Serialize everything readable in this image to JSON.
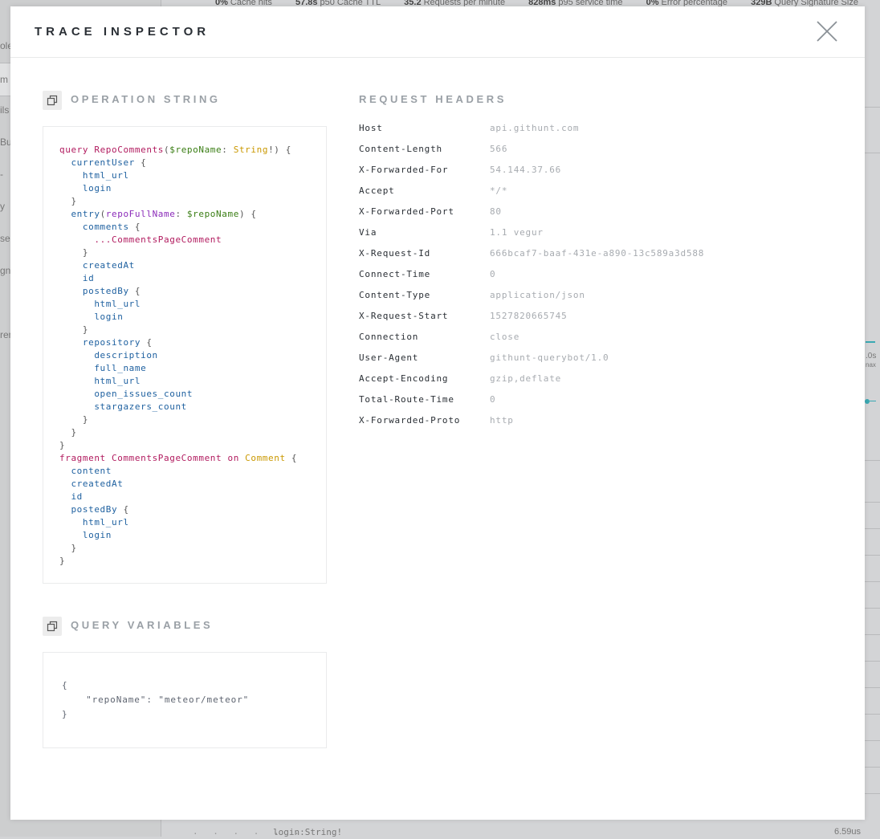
{
  "background": {
    "stats": [
      {
        "value": "0%",
        "label": "Cache hits"
      },
      {
        "value": "57.8s",
        "label": "p50 Cache TTL"
      },
      {
        "value": "35.2",
        "label": "Requests per minute"
      },
      {
        "value": "828ms",
        "label": "p95 service time"
      },
      {
        "value": "0%",
        "label": "Error percentage"
      },
      {
        "value": "329B",
        "label": "Query Signature Size"
      }
    ],
    "sidebar_fragments": [
      "ole",
      "m",
      "ils",
      "Bu",
      "-",
      "y",
      "ser",
      "gna",
      "rem"
    ],
    "bottom_row": {
      "dots": "· · · · · ·",
      "field": "login:String!",
      "duration": "6.59us"
    },
    "right_fragments": {
      "a": ".0s",
      "b": "nax"
    }
  },
  "modal": {
    "title": "TRACE INSPECTOR",
    "close_icon": "close-icon",
    "operation": {
      "title": "OPERATION STRING",
      "copy_icon": "copy-icon"
    },
    "variables": {
      "title": "QUERY VARIABLES",
      "copy_icon": "copy-icon",
      "text": "{\n    \"repoName\": \"meteor/meteor\"\n}"
    },
    "headers": {
      "title": "REQUEST HEADERS",
      "rows": [
        {
          "name": "Host",
          "value": "api.githunt.com"
        },
        {
          "name": "Content-Length",
          "value": "566"
        },
        {
          "name": "X-Forwarded-For",
          "value": "54.144.37.66"
        },
        {
          "name": "Accept",
          "value": "*/*"
        },
        {
          "name": "X-Forwarded-Port",
          "value": "80"
        },
        {
          "name": "Via",
          "value": "1.1 vegur"
        },
        {
          "name": "X-Request-Id",
          "value": "666bcaf7-baaf-431e-a890-13c589a3d588"
        },
        {
          "name": "Connect-Time",
          "value": "0"
        },
        {
          "name": "Content-Type",
          "value": "application/json"
        },
        {
          "name": "X-Request-Start",
          "value": "1527820665745"
        },
        {
          "name": "Connection",
          "value": "close"
        },
        {
          "name": "User-Agent",
          "value": "githunt-querybot/1.0"
        },
        {
          "name": "Accept-Encoding",
          "value": "gzip,deflate"
        },
        {
          "name": "Total-Route-Time",
          "value": "0"
        },
        {
          "name": "X-Forwarded-Proto",
          "value": "http"
        }
      ]
    }
  },
  "operation_code": [
    [
      [
        "kw",
        "query "
      ],
      [
        "def",
        "RepoComments"
      ],
      [
        "p",
        "("
      ],
      [
        "var",
        "$repoName"
      ],
      [
        "p",
        ": "
      ],
      [
        "type",
        "String"
      ],
      [
        "p",
        "!) {"
      ]
    ],
    [
      [
        "f",
        "  currentUser"
      ],
      [
        "p",
        " {"
      ]
    ],
    [
      [
        "f",
        "    html_url"
      ]
    ],
    [
      [
        "f",
        "    login"
      ]
    ],
    [
      [
        "p",
        "  }"
      ]
    ],
    [
      [
        "f",
        "  entry"
      ],
      [
        "p",
        "("
      ],
      [
        "arg",
        "repoFullName"
      ],
      [
        "p",
        ": "
      ],
      [
        "var",
        "$repoName"
      ],
      [
        "p",
        ") {"
      ]
    ],
    [
      [
        "f",
        "    comments"
      ],
      [
        "p",
        " {"
      ]
    ],
    [
      [
        "p",
        "      "
      ],
      [
        "def",
        "...CommentsPageComment"
      ]
    ],
    [
      [
        "p",
        "    }"
      ]
    ],
    [
      [
        "f",
        "    createdAt"
      ]
    ],
    [
      [
        "f",
        "    id"
      ]
    ],
    [
      [
        "f",
        "    postedBy"
      ],
      [
        "p",
        " {"
      ]
    ],
    [
      [
        "f",
        "      html_url"
      ]
    ],
    [
      [
        "f",
        "      login"
      ]
    ],
    [
      [
        "p",
        "    }"
      ]
    ],
    [
      [
        "f",
        "    repository"
      ],
      [
        "p",
        " {"
      ]
    ],
    [
      [
        "f",
        "      description"
      ]
    ],
    [
      [
        "f",
        "      full_name"
      ]
    ],
    [
      [
        "f",
        "      html_url"
      ]
    ],
    [
      [
        "f",
        "      open_issues_count"
      ]
    ],
    [
      [
        "f",
        "      stargazers_count"
      ]
    ],
    [
      [
        "p",
        "    }"
      ]
    ],
    [
      [
        "p",
        "  }"
      ]
    ],
    [
      [
        "p",
        "}"
      ]
    ],
    [
      [
        "kw",
        "fragment "
      ],
      [
        "def",
        "CommentsPageComment"
      ],
      [
        "kw",
        " on "
      ],
      [
        "type",
        "Comment"
      ],
      [
        "p",
        " {"
      ]
    ],
    [
      [
        "f",
        "  content"
      ]
    ],
    [
      [
        "f",
        "  createdAt"
      ]
    ],
    [
      [
        "f",
        "  id"
      ]
    ],
    [
      [
        "f",
        "  postedBy"
      ],
      [
        "p",
        " {"
      ]
    ],
    [
      [
        "f",
        "    html_url"
      ]
    ],
    [
      [
        "f",
        "    login"
      ]
    ],
    [
      [
        "p",
        "  }"
      ]
    ],
    [
      [
        "p",
        "}"
      ]
    ]
  ]
}
